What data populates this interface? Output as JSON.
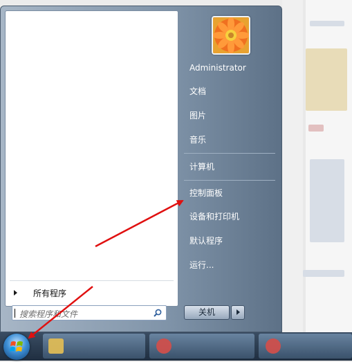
{
  "start_menu": {
    "user_name": "Administrator",
    "right_items": [
      "文档",
      "图片",
      "音乐",
      "计算机",
      "控制面板",
      "设备和打印机",
      "默认程序",
      "运行..."
    ],
    "all_programs_label": "所有程序",
    "search_placeholder": "搜索程序和文件",
    "shutdown_label": "关机"
  },
  "colors": {
    "annotation_arrow": "#e01010",
    "menu_gradient_start": "#a7b6c6",
    "menu_gradient_end": "#5d7187"
  }
}
